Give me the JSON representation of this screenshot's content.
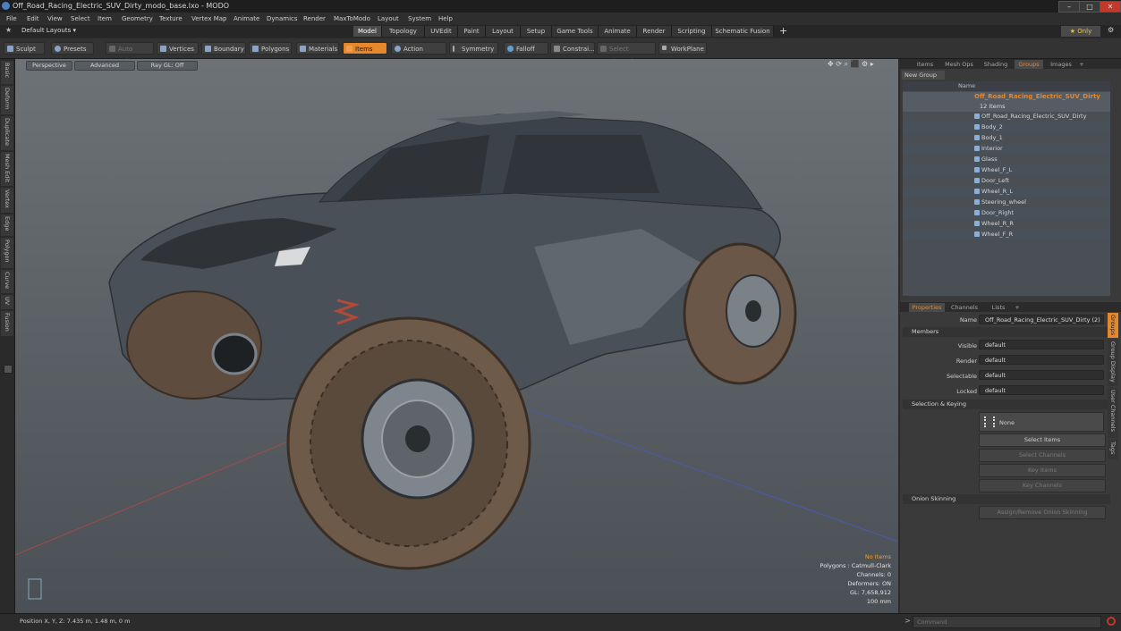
{
  "window": {
    "title": "Off_Road_Racing_Electric_SUV_Dirty_modo_base.lxo - MODO",
    "minimize": "–",
    "maximize": "□",
    "close": "✕"
  },
  "menu": [
    "File",
    "Edit",
    "View",
    "Select",
    "Item",
    "Geometry",
    "Texture",
    "Vertex Map",
    "Animate",
    "Dynamics",
    "Render",
    "MaxToModo",
    "Layout",
    "System",
    "Help"
  ],
  "layout": {
    "selector": "Default Layouts ▾",
    "tabs": [
      "Model",
      "Topology",
      "UVEdit",
      "Paint",
      "Layout",
      "Setup",
      "Game Tools",
      "Animate",
      "Render",
      "Scripting",
      "Schematic Fusion"
    ],
    "active_tab": "Model",
    "add": "+",
    "only": "★ Only",
    "settings": "⚙"
  },
  "toolbar": {
    "sculpt": "Sculpt",
    "presets": "Presets",
    "auto_select": "Auto Select",
    "vertices": "Vertices",
    "boundary": "Boundary",
    "polygons": "Polygons",
    "materials": "Materials",
    "items": "Items",
    "action_center": "Action Center",
    "symmetry": "Symmetry",
    "falloff": "Falloff",
    "constraint": "Constrai...",
    "select_through": "Select Through",
    "workplane": "WorkPlane"
  },
  "left_tabs": [
    "Basic",
    "Deform",
    "Duplicate",
    "Mesh Edit",
    "Vertex",
    "Edge",
    "Polygon",
    "Curve",
    "UV",
    "Fusion"
  ],
  "viewport": {
    "view": "Perspective",
    "shading": "Advanced",
    "raygl": "Ray GL: Off",
    "icons": "✥ ⟳ ⌕ ⬛ ⚙ ▸",
    "stats": [
      "No Items",
      "Polygons : Catmull-Clark",
      "Channels: 0",
      "Deformers: ON",
      "GL: 7,658,912",
      "100 mm"
    ]
  },
  "status": {
    "position": "Position X, Y, Z:   7.435 m, 1.48 m, 0 m",
    "command_placeholder": "Command"
  },
  "groups_panel": {
    "tabs": [
      "Items",
      "Mesh Ops",
      "Shading",
      "Groups",
      "Images",
      "+"
    ],
    "active_tab": "Groups",
    "new_group": "New Group",
    "col_name": "Name",
    "group_name": "Off_Road_Racing_Electric_SUV_Dirty",
    "group_count": "12 Items",
    "items": [
      "Off_Road_Racing_Electric_SUV_Dirty",
      "Body_2",
      "Body_1",
      "Interior",
      "Glass",
      "Wheel_F_L",
      "Door_Left",
      "Wheel_R_L",
      "Steering_wheel",
      "Door_Right",
      "Wheel_R_R",
      "Wheel_F_R"
    ]
  },
  "properties_panel": {
    "tabs": [
      "Properties",
      "Channels",
      "Lists",
      "+"
    ],
    "active_tab": "Properties",
    "name_label": "Name",
    "name_value": "Off_Road_Racing_Electric_SUV_Dirty (2)",
    "members": "Members",
    "fields": [
      {
        "label": "Visible",
        "value": "default"
      },
      {
        "label": "Render",
        "value": "default"
      },
      {
        "label": "Selectable",
        "value": "default"
      },
      {
        "label": "Locked",
        "value": "default"
      }
    ],
    "selection_keying": "Selection & Keying",
    "none": "None",
    "select_items": "Select Items",
    "select_channels": "Select Channels",
    "key_items": "Key Items",
    "key_channels": "Key Channels",
    "onion_skinning": "Onion Skinning",
    "assign_onion": "Assign/Remove Onion Skinning",
    "side_tabs": [
      "Groups",
      "Group Display",
      "User Channels",
      "Tags"
    ]
  },
  "colors": {
    "accent": "#e6872b",
    "selection_row": "#48505a",
    "viewport_bg": "#5c6266"
  }
}
